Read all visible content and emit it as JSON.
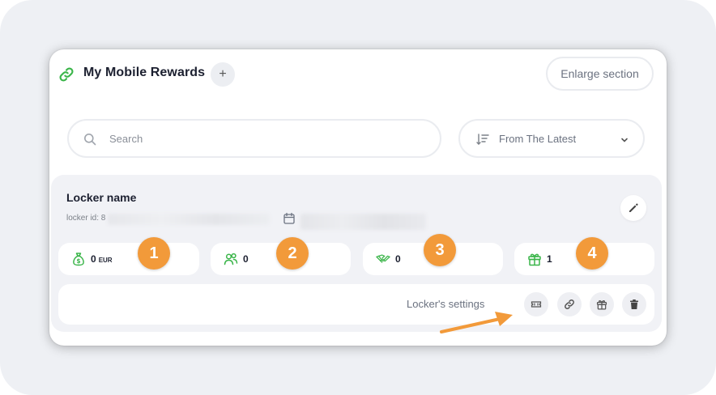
{
  "header": {
    "title": "My Mobile Rewards",
    "add_label": "+",
    "enlarge_label": "Enlarge section"
  },
  "search": {
    "placeholder": "Search"
  },
  "sort": {
    "label": "From The Latest"
  },
  "locker": {
    "name": "Locker name",
    "id_label": "locker id: 8"
  },
  "stats": [
    {
      "value": "0",
      "unit": "EUR",
      "icon": "money-bag-icon",
      "badge": "1"
    },
    {
      "value": "0",
      "icon": "users-icon",
      "badge": "2"
    },
    {
      "value": "0",
      "icon": "handshake-icon",
      "badge": "3"
    },
    {
      "value": "1",
      "icon": "gift-icon",
      "badge": "4"
    }
  ],
  "settings": {
    "label": "Locker's settings",
    "buttons": [
      "ticket-icon",
      "link-icon",
      "gift-icon",
      "trash-icon"
    ]
  },
  "colors": {
    "accent_green": "#3bb54a",
    "badge_orange": "#f29a3a",
    "background": "#eef0f4"
  }
}
